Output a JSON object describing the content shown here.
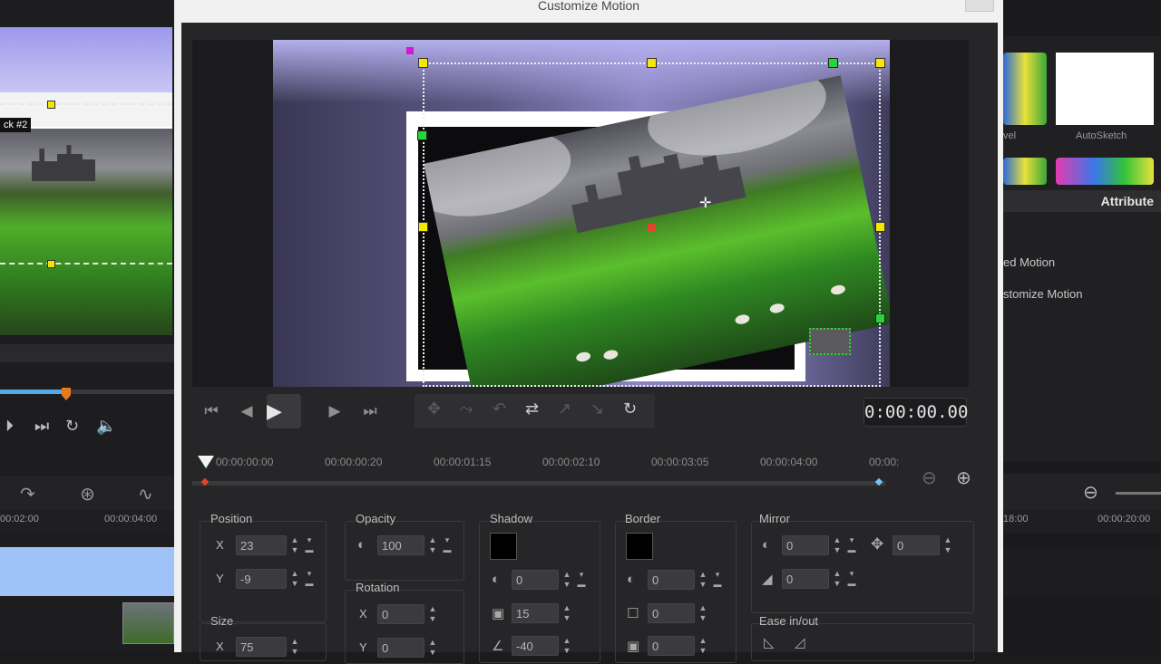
{
  "dialog": {
    "title": "Customize Motion",
    "timecode": "0:00:00.00",
    "ruler": [
      "00:00:00:00",
      "00:00:00:20",
      "00:00:01:15",
      "00:00:02:10",
      "00:00:03:05",
      "00:00:04:00",
      "00:00:"
    ]
  },
  "params": {
    "position": {
      "label": "Position",
      "x_label": "X",
      "x": "23",
      "y_label": "Y",
      "y": "-9"
    },
    "size": {
      "label": "Size",
      "x_label": "X",
      "x": "75"
    },
    "opacity": {
      "label": "Opacity",
      "value": "100"
    },
    "rotation": {
      "label": "Rotation",
      "x_label": "X",
      "x": "0",
      "y_label": "Y",
      "y": "0"
    },
    "shadow": {
      "label": "Shadow",
      "value1": "0",
      "value2": "15",
      "value3": "-40"
    },
    "border": {
      "label": "Border",
      "value1": "0",
      "value2": "0",
      "value3": "0"
    },
    "mirror": {
      "label": "Mirror",
      "value1": "0",
      "value2": "0",
      "value3": "0"
    },
    "ease": {
      "label": "Ease in/out"
    }
  },
  "background": {
    "left": {
      "track_label": "ck #2",
      "ruler": [
        "00:02:00",
        "00:00:04:00"
      ]
    },
    "right": {
      "tiles": [
        "vel",
        "AutoSketch"
      ],
      "attribute_tab": "Attribute",
      "menu": [
        "ed Motion",
        "stomize Motion"
      ],
      "ruler": [
        "18:00",
        "00:00:20:00"
      ]
    }
  },
  "colors": {
    "handle_yellow": "#f5e800",
    "handle_green": "#27d43a",
    "playhead_orange": "#e87a1d",
    "track_blue": "#55a8e6"
  }
}
